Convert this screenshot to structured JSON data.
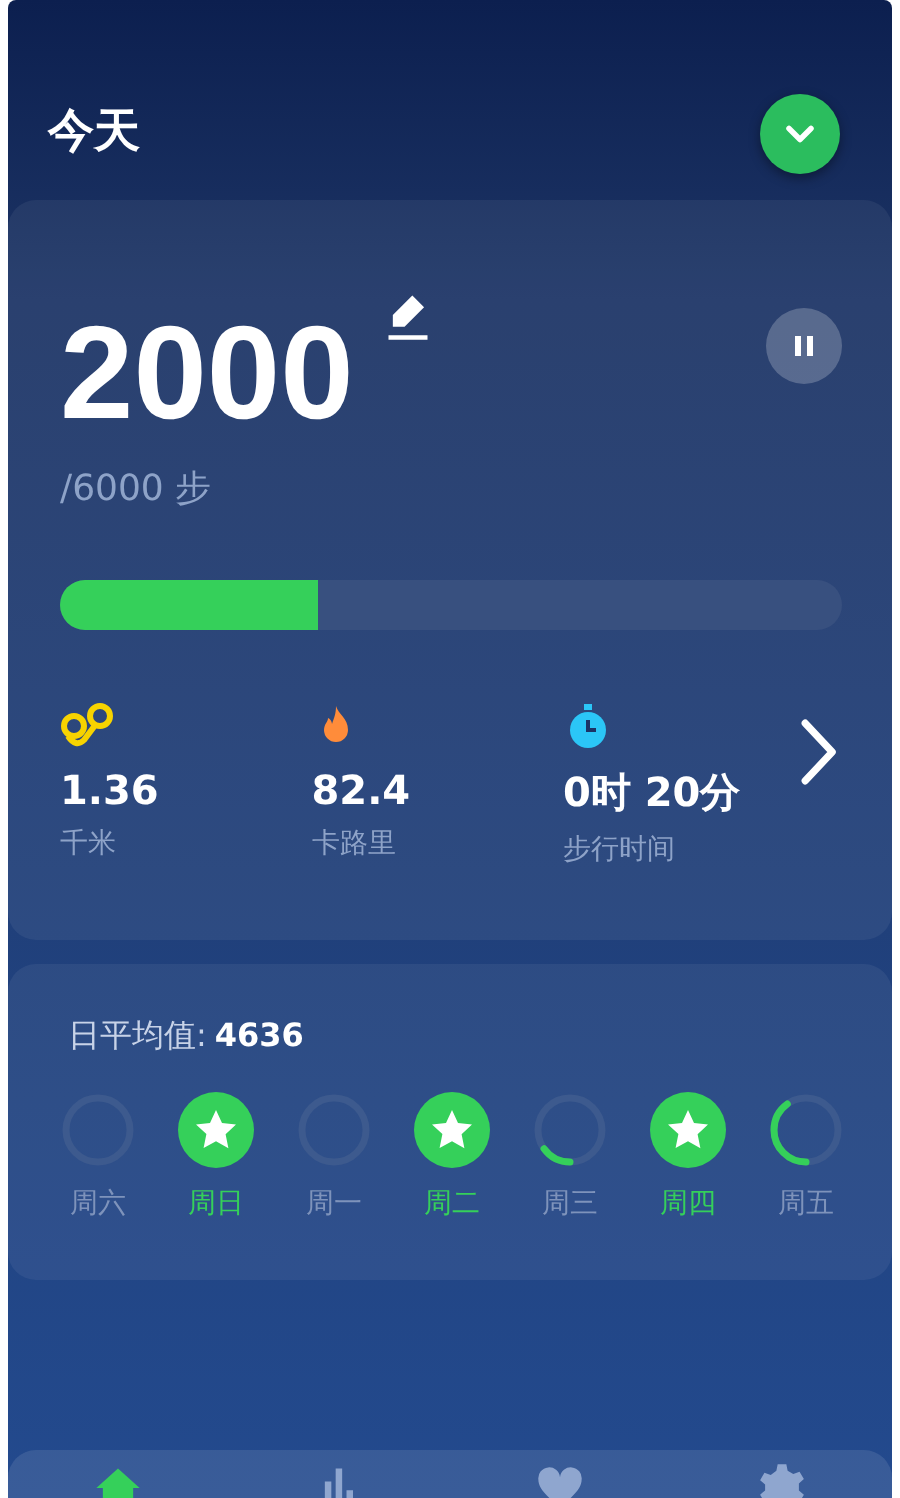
{
  "header": {
    "title": "今天"
  },
  "steps": {
    "count": "2000",
    "goal": "/6000 步",
    "level": 0.33
  },
  "stats": [
    {
      "kind": "distance",
      "value": "1.36",
      "label": "千米"
    },
    {
      "kind": "calories",
      "value": "82.4",
      "label": "卡路里"
    },
    {
      "kind": "time",
      "value": "0时 20分",
      "label": "步行时间"
    }
  ],
  "week": {
    "average_label": "日平均值:",
    "average_value": "4636",
    "days": [
      {
        "label": "周六",
        "kind": "none"
      },
      {
        "label": "周日",
        "kind": "full"
      },
      {
        "label": "周一",
        "kind": "none"
      },
      {
        "label": "周二",
        "kind": "full"
      },
      {
        "label": "周三",
        "kind": "low"
      },
      {
        "label": "周四",
        "kind": "full"
      },
      {
        "label": "周五",
        "kind": "mid"
      }
    ]
  },
  "nav": [
    {
      "kind": "home",
      "selected": true
    },
    {
      "kind": "chart",
      "selected": false
    },
    {
      "kind": "heart",
      "selected": false
    },
    {
      "kind": "settings",
      "selected": false
    }
  ]
}
